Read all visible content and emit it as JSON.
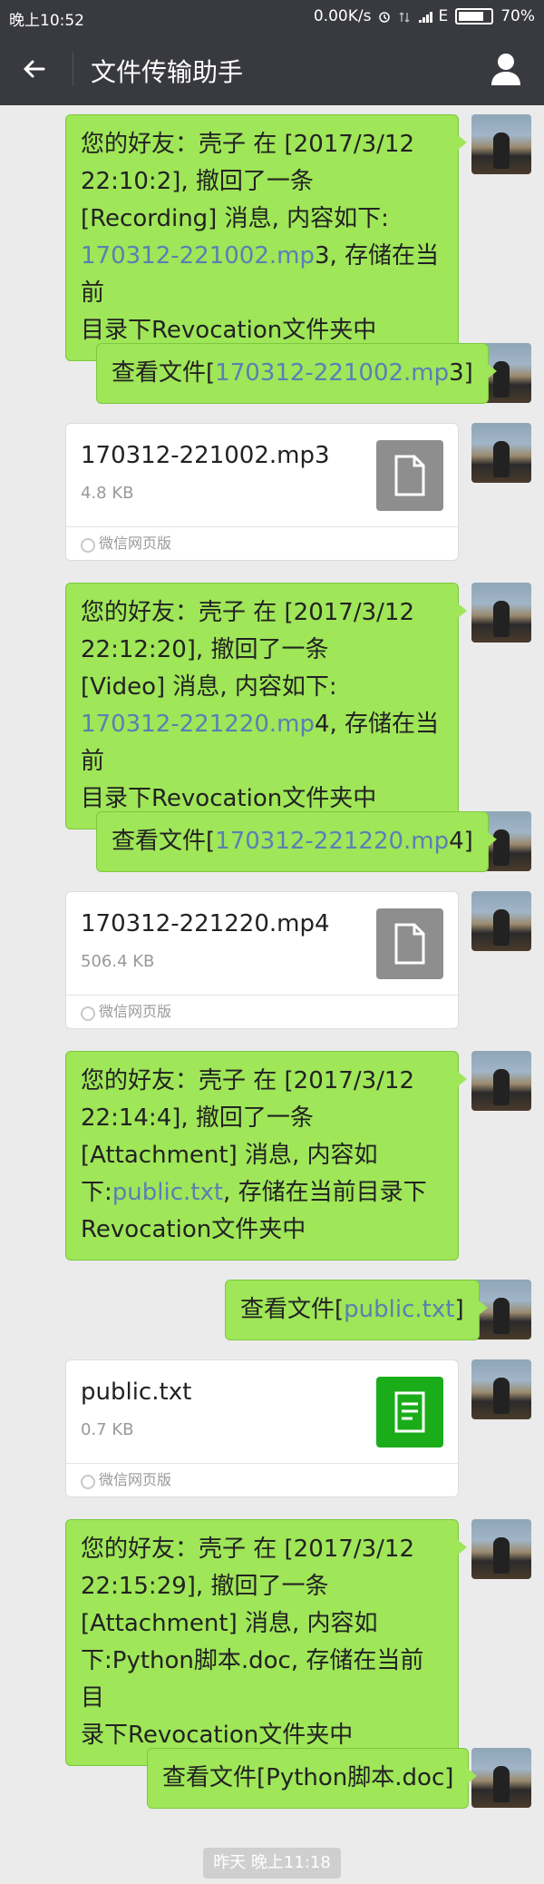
{
  "status_bar": {
    "time": "晚上10:52",
    "speed": "0.00K/s",
    "network": "E",
    "battery": "70%"
  },
  "header": {
    "title": "文件传输助手"
  },
  "messages": [
    {
      "type": "text",
      "lines": [
        "您的好友：壳子  在 [2017/3/12",
        "22:10:2], 撤回了一条",
        "[Recording] 消息, 内容如下:",
        "170312-221002.mp3, 存储在当前",
        "目录下Revocation文件夹中"
      ],
      "link": "170312-221002.mp"
    },
    {
      "type": "view",
      "prefix": "查看文件[",
      "link": "170312-221002.mp",
      "suffix": "3]"
    },
    {
      "type": "file",
      "name": "170312-221002.mp3",
      "size": "4.8 KB",
      "source": "微信网页版",
      "icon": "document-icon"
    },
    {
      "type": "text",
      "lines": [
        "您的好友：壳子  在 [2017/3/12",
        "22:12:20], 撤回了一条",
        "[Video] 消息, 内容如下:",
        "170312-221220.mp4, 存储在当前",
        "目录下Revocation文件夹中"
      ],
      "link": "170312-221220.mp"
    },
    {
      "type": "view",
      "prefix": "查看文件[",
      "link": "170312-221220.mp",
      "suffix": "4]"
    },
    {
      "type": "file",
      "name": "170312-221220.mp4",
      "size": "506.4 KB",
      "source": "微信网页版",
      "icon": "document-icon"
    },
    {
      "type": "text",
      "lines": [
        "您的好友：壳子  在 [2017/3/12",
        "22:14:4], 撤回了一条",
        "[Attachment] 消息, 内容如",
        "下:public.txt, 存储在当前目录下",
        "Revocation文件夹中"
      ],
      "link": "public.txt"
    },
    {
      "type": "view",
      "prefix": "查看文件[",
      "link": "public.txt",
      "suffix": "]"
    },
    {
      "type": "file",
      "name": "public.txt",
      "size": "0.7 KB",
      "source": "微信网页版",
      "icon": "text-file-icon"
    },
    {
      "type": "text",
      "lines": [
        "您的好友：壳子  在 [2017/3/12",
        "22:15:29], 撤回了一条",
        "[Attachment] 消息, 内容如",
        "下:Python脚本.doc, 存储在当前目",
        "录下Revocation文件夹中"
      ]
    },
    {
      "type": "view",
      "prefix": "查看文件[Python脚本.doc]"
    }
  ],
  "time_badge": "昨天 晚上11:18"
}
